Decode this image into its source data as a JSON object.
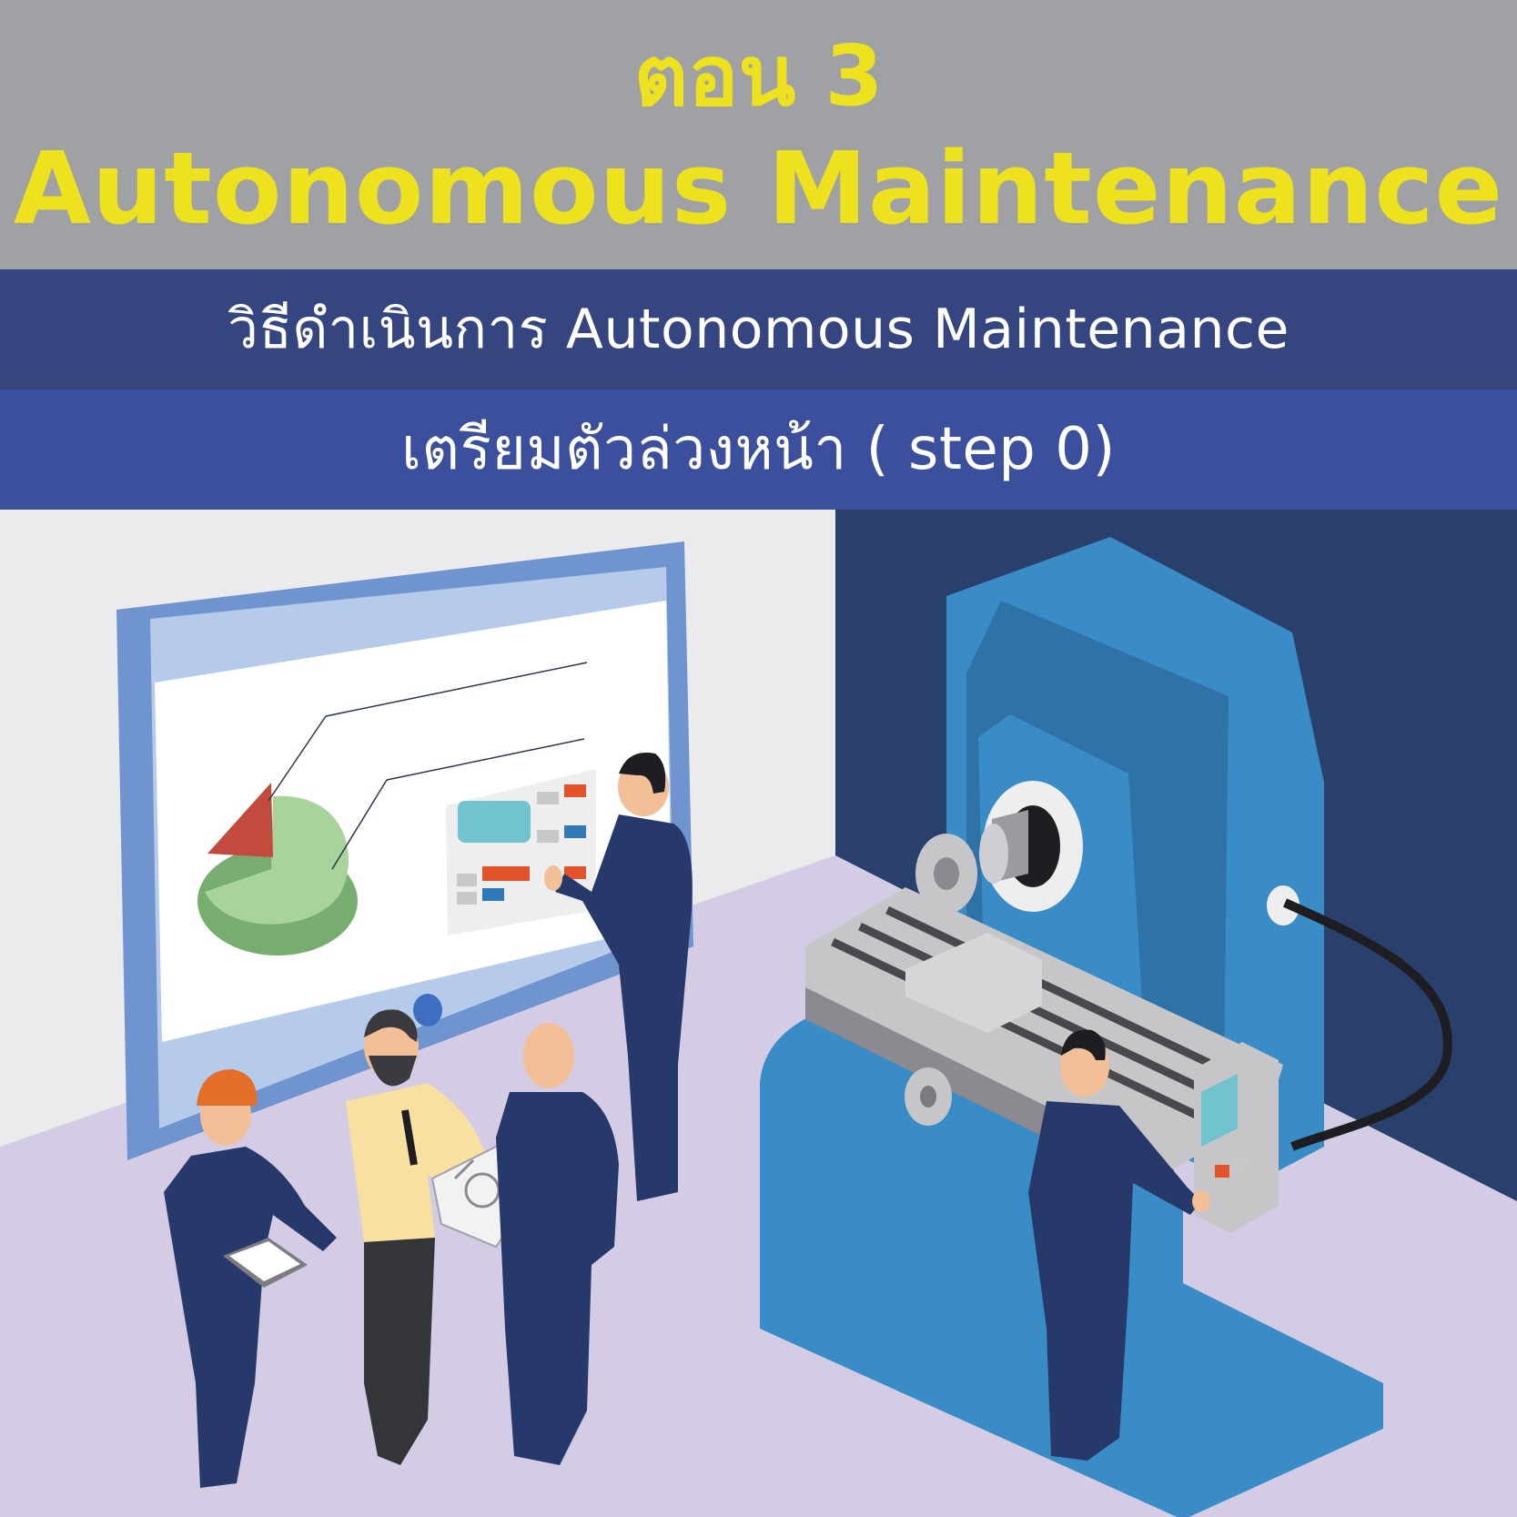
{
  "header": {
    "episode": "ตอน 3",
    "title": "Autonomous Maintenance",
    "background_color": "#a0a1a5",
    "text_color": "#eee21e"
  },
  "subtitle": {
    "text": "วิธีดำเนินการ Autonomous Maintenance",
    "background_color": "#35457f"
  },
  "step": {
    "text": "เตรียมตัวล่วงหน้า ( step 0)",
    "background_color": "#3b4f9c"
  },
  "illustration": {
    "description_icons": [
      "presentation-screen-icon",
      "milling-machine-icon",
      "worker-icon",
      "pie-chart-icon",
      "tablet-icon",
      "blueprint-icon"
    ],
    "colors": {
      "wall": "#ececee",
      "dark_wall": "#2a406c",
      "floor": "#d4cbe4",
      "machine": "#3a8cc6",
      "uniform": "#27386b"
    }
  }
}
